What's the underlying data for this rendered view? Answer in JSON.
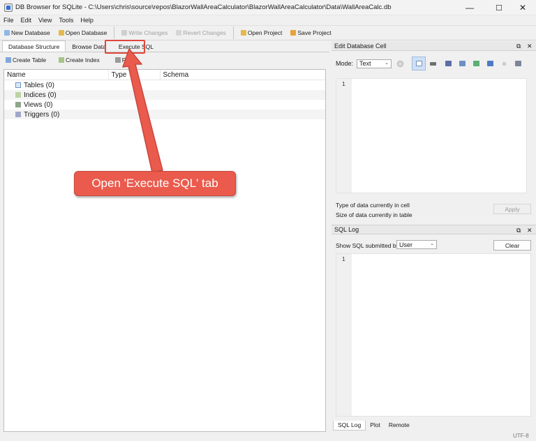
{
  "window": {
    "title": "DB Browser for SQLite - C:\\Users\\chris\\source\\repos\\BlazorWallAreaCalculator\\BlazorWallAreaCalculator\\Data\\WallAreaCalc.db",
    "minimize": "—",
    "maximize": "☐",
    "close": "✕"
  },
  "menu": [
    "File",
    "Edit",
    "View",
    "Tools",
    "Help"
  ],
  "toolbar": {
    "new_db": "New Database",
    "open_db": "Open Database",
    "write_changes": "Write Changes",
    "revert_changes": "Revert Changes",
    "open_project": "Open Project",
    "save_project": "Save Project"
  },
  "tabs": [
    "Database Structure",
    "Browse Data",
    "Execute SQL"
  ],
  "structure_toolbar": {
    "create_table": "Create Table",
    "create_index": "Create Index",
    "print": "Print"
  },
  "tree": {
    "columns": [
      "Name",
      "Type",
      "Schema"
    ],
    "rows": [
      "Tables (0)",
      "Indices (0)",
      "Views (0)",
      "Triggers (0)"
    ]
  },
  "edit_cell": {
    "title": "Edit Database Cell",
    "mode_label": "Mode:",
    "mode_value": "Text",
    "line_number": "1",
    "type_info": "Type of data currently in cell",
    "size_info": "Size of data currently in table",
    "apply": "Apply"
  },
  "sql_log": {
    "title": "SQL Log",
    "show_label": "Show SQL submitted by",
    "show_value": "User",
    "clear": "Clear",
    "line_number": "1"
  },
  "bottom_tabs": [
    "SQL Log",
    "Plot",
    "Remote"
  ],
  "status": {
    "encoding": "UTF-8"
  },
  "annotation": {
    "text": "Open 'Execute SQL' tab"
  },
  "dock_controls": {
    "float": "⧉",
    "close": "✕"
  },
  "colors": {
    "callout": "#ea5b4d",
    "highlight": "#e0473a"
  }
}
